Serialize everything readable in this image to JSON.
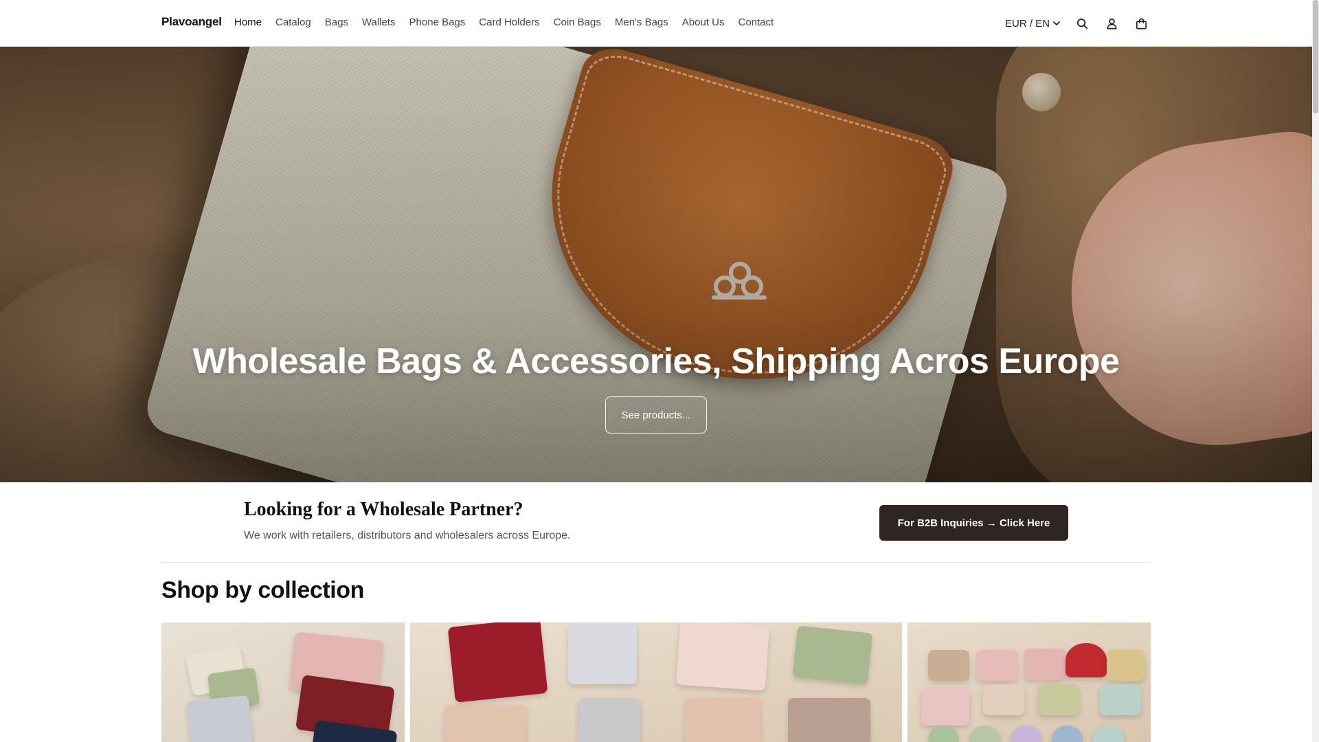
{
  "header": {
    "brand": "Plavoangel",
    "nav": [
      "Home",
      "Catalog",
      "Bags",
      "Wallets",
      "Phone Bags",
      "Card Holders",
      "Coin Bags",
      "Men's Bags",
      "About Us",
      "Contact"
    ],
    "locale": "EUR / EN",
    "icons": [
      "search-icon",
      "account-icon",
      "cart-icon"
    ]
  },
  "hero": {
    "title": "Wholesale Bags & Accessories, Shipping Acros Europe",
    "button": "See products..."
  },
  "wholesale": {
    "title": "Looking for a Wholesale Partner?",
    "subtitle": "We work with retailers, distributors and wholesalers across Europe.",
    "button": "For B2B Inquiries → Click Here"
  },
  "collections": {
    "title": "Shop by collection"
  },
  "colors": {
    "b2b_button_bg": "#2e2622",
    "text": "#111111",
    "muted": "#555555"
  }
}
